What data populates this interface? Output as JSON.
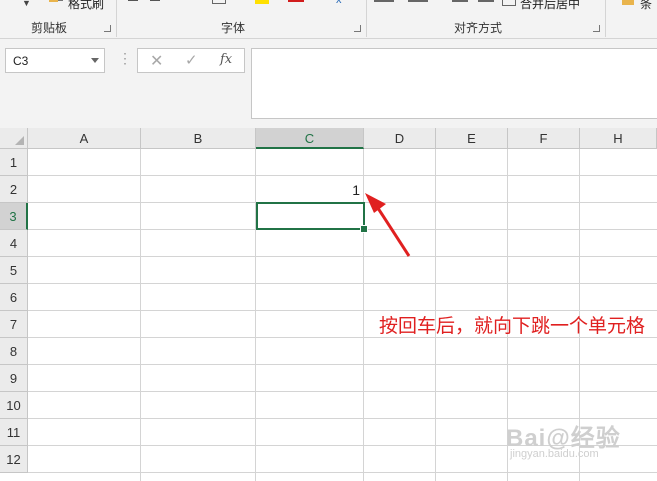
{
  "ribbon": {
    "format_painter_label": "格式刷",
    "merge_label": "合并后居中",
    "right_partial_label": "条",
    "groups": {
      "clipboard": "剪贴板",
      "font": "字体",
      "alignment": "对齐方式"
    }
  },
  "formula_bar": {
    "name_box_value": "C3",
    "fx_label": "fx",
    "formula_value": ""
  },
  "sheet": {
    "columns": [
      "A",
      "B",
      "C",
      "D",
      "E",
      "F",
      "H"
    ],
    "rows": [
      "1",
      "2",
      "3",
      "4",
      "5",
      "6",
      "7",
      "8",
      "9",
      "10",
      "11",
      "12"
    ],
    "selected_column": "C",
    "selected_row": "3",
    "cell_C2_value": "1"
  },
  "annotation": {
    "text": "按回车后，就向下跳一个单元格",
    "color": "#e02020"
  },
  "watermark": {
    "logo": "Bai@经验",
    "url": "jingyan.baidu.com"
  },
  "colors": {
    "excel_green": "#217346",
    "ribbon_bg": "#f3f3f3"
  }
}
